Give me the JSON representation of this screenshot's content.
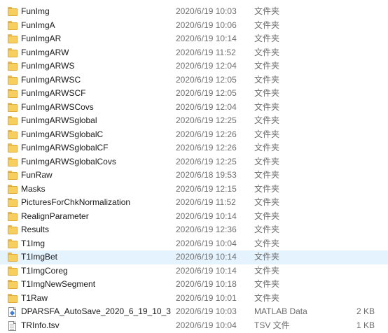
{
  "colors": {
    "selected_row": "#e5f3ff",
    "folder": "#f7cf5e",
    "secondary_text": "#6d6d6d"
  },
  "files": [
    {
      "name": "FunImg",
      "date": "2020/6/19 10:03",
      "type": "文件夹",
      "size": "",
      "icon": "folder-icon"
    },
    {
      "name": "FunImgA",
      "date": "2020/6/19 10:06",
      "type": "文件夹",
      "size": "",
      "icon": "folder-icon"
    },
    {
      "name": "FunImgAR",
      "date": "2020/6/19 10:14",
      "type": "文件夹",
      "size": "",
      "icon": "folder-icon"
    },
    {
      "name": "FunImgARW",
      "date": "2020/6/19 11:52",
      "type": "文件夹",
      "size": "",
      "icon": "folder-icon"
    },
    {
      "name": "FunImgARWS",
      "date": "2020/6/19 12:04",
      "type": "文件夹",
      "size": "",
      "icon": "folder-icon"
    },
    {
      "name": "FunImgARWSC",
      "date": "2020/6/19 12:05",
      "type": "文件夹",
      "size": "",
      "icon": "folder-icon"
    },
    {
      "name": "FunImgARWSCF",
      "date": "2020/6/19 12:05",
      "type": "文件夹",
      "size": "",
      "icon": "folder-icon"
    },
    {
      "name": "FunImgARWSCovs",
      "date": "2020/6/19 12:04",
      "type": "文件夹",
      "size": "",
      "icon": "folder-icon"
    },
    {
      "name": "FunImgARWSglobal",
      "date": "2020/6/19 12:25",
      "type": "文件夹",
      "size": "",
      "icon": "folder-icon"
    },
    {
      "name": "FunImgARWSglobalC",
      "date": "2020/6/19 12:26",
      "type": "文件夹",
      "size": "",
      "icon": "folder-icon"
    },
    {
      "name": "FunImgARWSglobalCF",
      "date": "2020/6/19 12:26",
      "type": "文件夹",
      "size": "",
      "icon": "folder-icon"
    },
    {
      "name": "FunImgARWSglobalCovs",
      "date": "2020/6/19 12:25",
      "type": "文件夹",
      "size": "",
      "icon": "folder-icon"
    },
    {
      "name": "FunRaw",
      "date": "2020/6/18 19:53",
      "type": "文件夹",
      "size": "",
      "icon": "folder-icon"
    },
    {
      "name": "Masks",
      "date": "2020/6/19 12:15",
      "type": "文件夹",
      "size": "",
      "icon": "folder-icon"
    },
    {
      "name": "PicturesForChkNormalization",
      "date": "2020/6/19 11:52",
      "type": "文件夹",
      "size": "",
      "icon": "folder-icon"
    },
    {
      "name": "RealignParameter",
      "date": "2020/6/19 10:14",
      "type": "文件夹",
      "size": "",
      "icon": "folder-icon"
    },
    {
      "name": "Results",
      "date": "2020/6/19 12:36",
      "type": "文件夹",
      "size": "",
      "icon": "folder-icon"
    },
    {
      "name": "T1Img",
      "date": "2020/6/19 10:04",
      "type": "文件夹",
      "size": "",
      "icon": "folder-icon"
    },
    {
      "name": "T1ImgBet",
      "date": "2020/6/19 10:14",
      "type": "文件夹",
      "size": "",
      "icon": "folder-icon",
      "selected": true
    },
    {
      "name": "T1ImgCoreg",
      "date": "2020/6/19 10:14",
      "type": "文件夹",
      "size": "",
      "icon": "folder-icon"
    },
    {
      "name": "T1ImgNewSegment",
      "date": "2020/6/19 10:18",
      "type": "文件夹",
      "size": "",
      "icon": "folder-icon"
    },
    {
      "name": "T1Raw",
      "date": "2020/6/19 10:01",
      "type": "文件夹",
      "size": "",
      "icon": "folder-icon"
    },
    {
      "name": "DPARSFA_AutoSave_2020_6_19_10_3....",
      "date": "2020/6/19 10:03",
      "type": "MATLAB Data",
      "size": "2 KB",
      "icon": "matlab-data-file-icon"
    },
    {
      "name": "TRInfo.tsv",
      "date": "2020/6/19 10:04",
      "type": "TSV 文件",
      "size": "1 KB",
      "icon": "text-file-icon"
    }
  ]
}
